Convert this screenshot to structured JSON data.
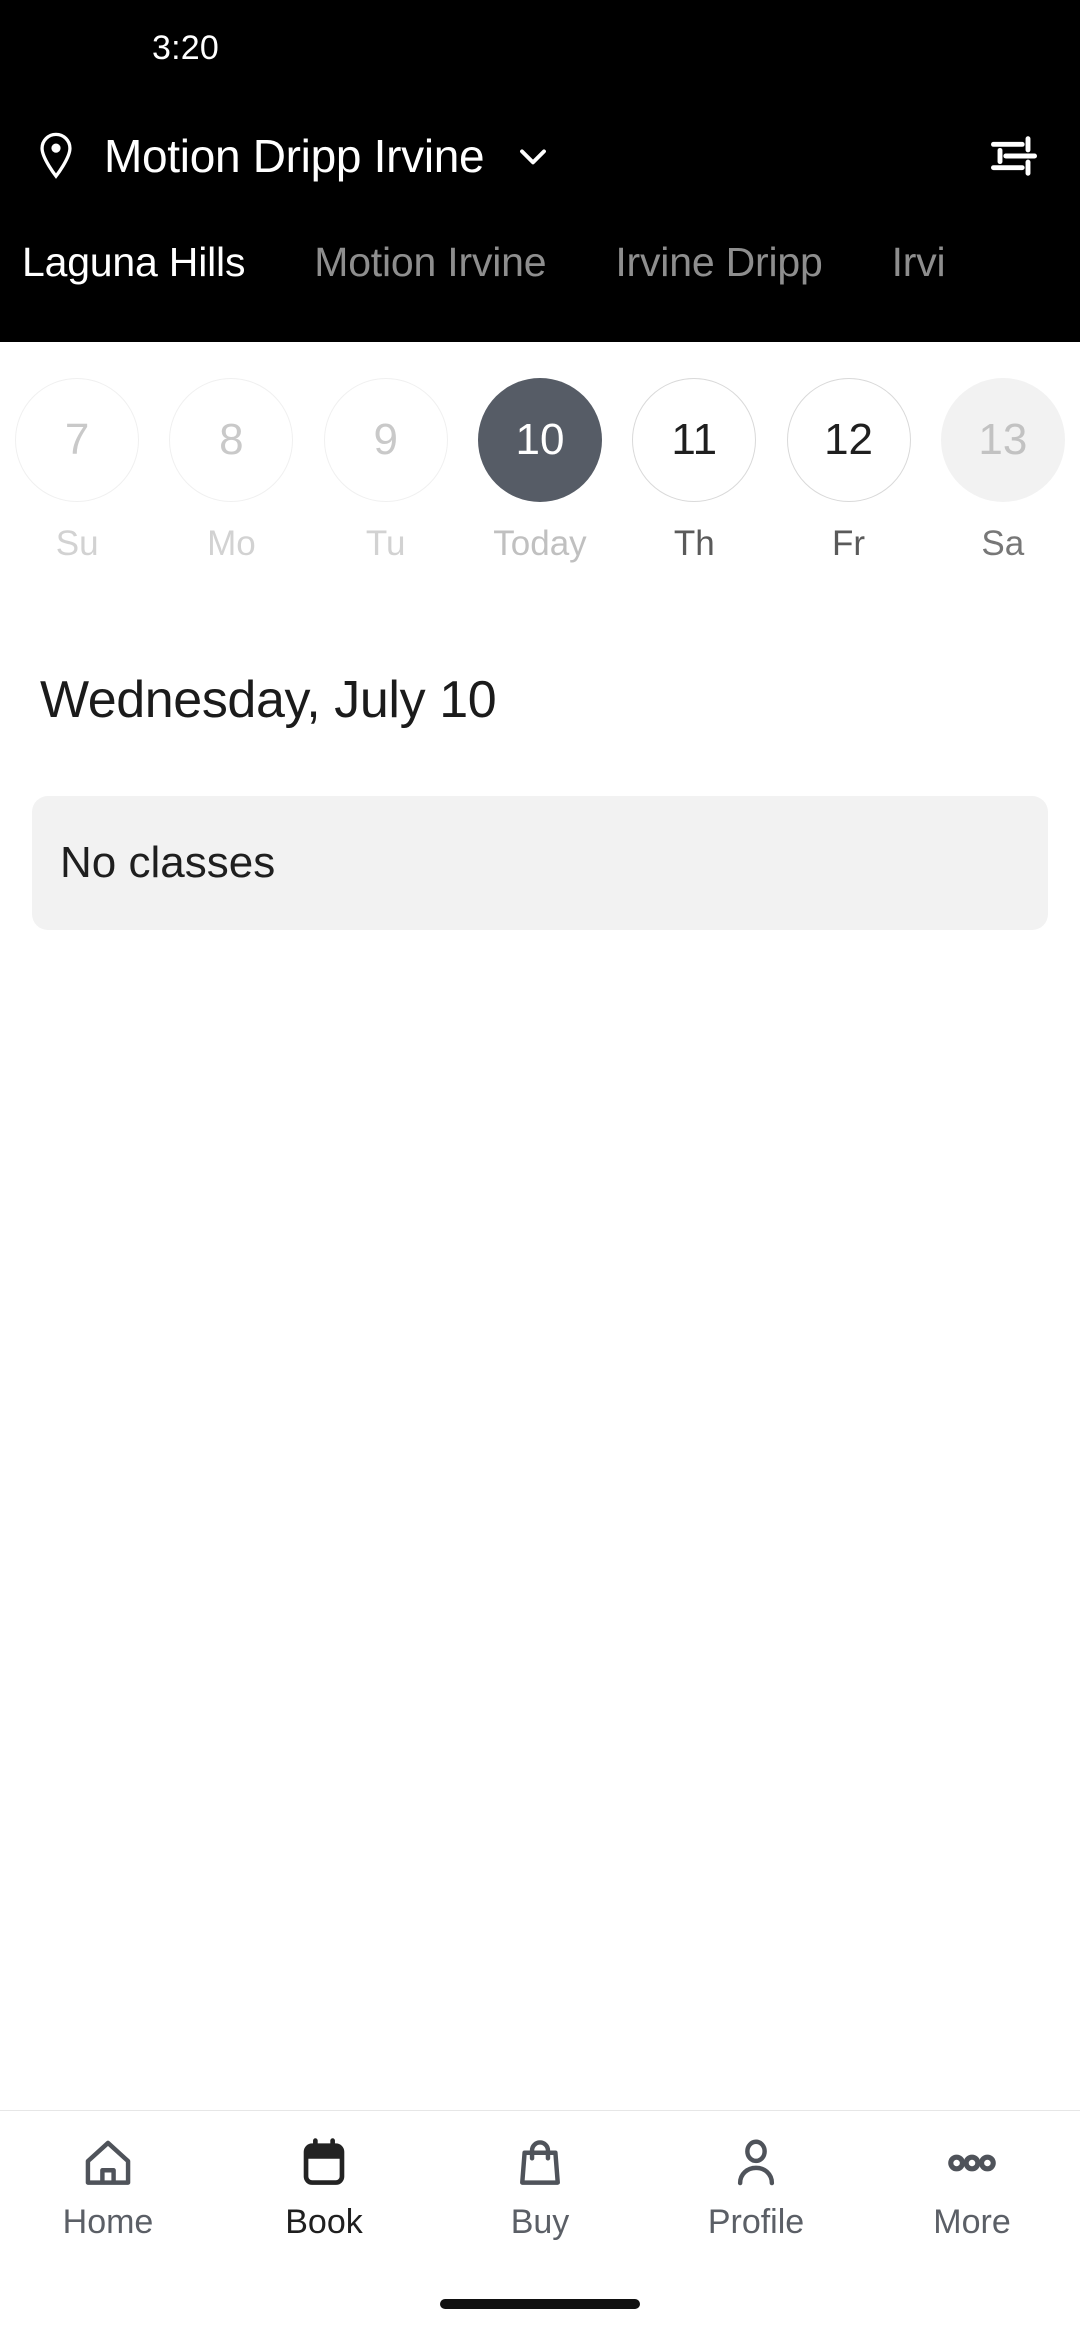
{
  "status_bar": {
    "time": "3:20"
  },
  "header": {
    "pin_icon": "location-pin-icon",
    "venue": "Motion Dripp Irvine",
    "chevron_icon": "chevron-down-icon",
    "filter_icon": "tune-filter-icon"
  },
  "location_tabs": {
    "active_index": 0,
    "items": [
      {
        "label": "Laguna Hills"
      },
      {
        "label": "Motion Irvine"
      },
      {
        "label": "Irvine Dripp"
      },
      {
        "label": "Irvi"
      }
    ]
  },
  "date_strip": [
    {
      "day": "7",
      "label": "Su",
      "state": "past"
    },
    {
      "day": "8",
      "label": "Mo",
      "state": "past"
    },
    {
      "day": "9",
      "label": "Tu",
      "state": "past"
    },
    {
      "day": "10",
      "label": "Today",
      "state": "today"
    },
    {
      "day": "11",
      "label": "Th",
      "state": "future"
    },
    {
      "day": "12",
      "label": "Fr",
      "state": "future"
    },
    {
      "day": "13",
      "label": "Sa",
      "state": "muted"
    }
  ],
  "schedule": {
    "day_heading": "Wednesday, July 10",
    "empty_message": "No classes"
  },
  "bottom_nav": {
    "active_index": 1,
    "items": [
      {
        "label": "Home",
        "icon": "home-icon"
      },
      {
        "label": "Book",
        "icon": "calendar-icon"
      },
      {
        "label": "Buy",
        "icon": "shopping-bag-icon"
      },
      {
        "label": "Profile",
        "icon": "person-icon"
      },
      {
        "label": "More",
        "icon": "ellipsis-icon"
      }
    ]
  },
  "colors": {
    "header_bg": "#000000",
    "today_fill": "#565c66",
    "card_bg": "#f2f2f2",
    "nav_icon": "#4f535a"
  }
}
